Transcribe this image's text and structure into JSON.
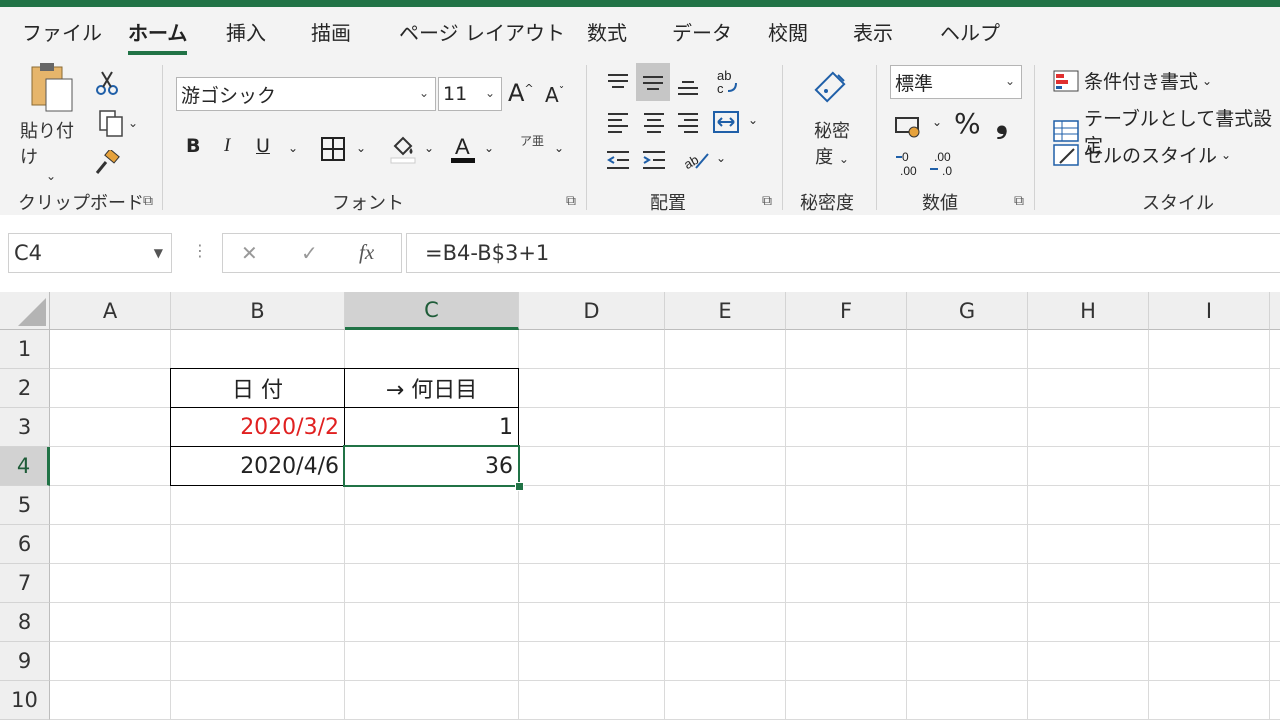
{
  "tabs": [
    "ファイル",
    "ホーム",
    "挿入",
    "描画",
    "ページ レイアウト",
    "数式",
    "データ",
    "校閲",
    "表示",
    "ヘルプ"
  ],
  "active_tab": "ホーム",
  "clipboard": {
    "paste_label": "貼り付け",
    "group_label": "クリップボード"
  },
  "font": {
    "name": "游ゴシック",
    "size": "11",
    "group_label": "フォント",
    "bold": "B",
    "italic": "I",
    "underline": "U",
    "furigana": "ア亜"
  },
  "alignment": {
    "group_label": "配置"
  },
  "sensitivity": {
    "label_line1": "秘密",
    "label_line2": "度",
    "group_label": "秘密度"
  },
  "number": {
    "format": "標準",
    "percent": "%",
    "comma": "❟",
    "group_label": "数値"
  },
  "styles": {
    "conditional": "条件付き書式",
    "table": "テーブルとして書式設定",
    "cell_styles": "セルのスタイル",
    "group_label": "スタイル"
  },
  "formula_bar": {
    "name_box": "C4",
    "cancel": "✕",
    "enter": "✓",
    "fx": "fx",
    "formula": "=B4-B$3+1"
  },
  "columns": [
    "A",
    "B",
    "C",
    "D",
    "E",
    "F",
    "G",
    "H",
    "I"
  ],
  "selected_column": "C",
  "rows": [
    "1",
    "2",
    "3",
    "4",
    "5",
    "6",
    "7",
    "8",
    "9",
    "10"
  ],
  "selected_row": "4",
  "cells": {
    "B2": "日 付",
    "C2": "→ 何日目",
    "B3": "2020/3/2",
    "C3": "1",
    "B4": "2020/4/6",
    "C4": "36"
  },
  "colors": {
    "accent": "#217346",
    "red_text": "#e02020"
  }
}
